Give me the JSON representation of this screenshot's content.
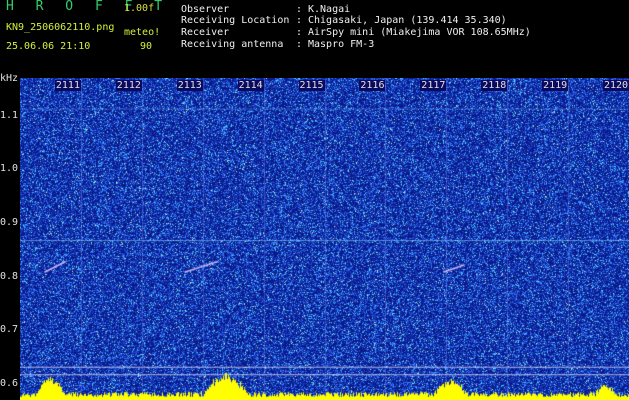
{
  "app": {
    "brand": "H R O F F T",
    "version": "1.00f",
    "filename": "KN9_2506062110.png",
    "station": "meteo!",
    "datetime": "25.06.06 21:10",
    "count": "90"
  },
  "info": {
    "rows": [
      {
        "label": "Observer",
        "sep": ":",
        "value": "K.Nagai"
      },
      {
        "label": "Receiving Location",
        "sep": ":",
        "value": "Chigasaki, Japan (139.414 35.340)"
      },
      {
        "label": "Receiver",
        "sep": ":",
        "value": "AirSpy mini (Miakejima VOR 108.65MHz)"
      },
      {
        "label": "Receiving antenna",
        "sep": ":",
        "value": "Maspro FM-3"
      }
    ]
  },
  "chart_data": {
    "type": "heatmap",
    "ylabel": "kHz",
    "y_ticks": [
      "1.1",
      "1.0",
      "0.9",
      "0.8",
      "0.7",
      "0.6"
    ],
    "ylim": [
      0.57,
      1.17
    ],
    "x_ticks": [
      "2111",
      "2112",
      "2113",
      "2114",
      "2115",
      "2116",
      "2117",
      "2118",
      "2119",
      "2120"
    ],
    "xlim": [
      2110,
      2120
    ],
    "colors": {
      "background": "#0a1a8c",
      "noise": "#3a7cff",
      "signal": "#ffff00"
    }
  }
}
